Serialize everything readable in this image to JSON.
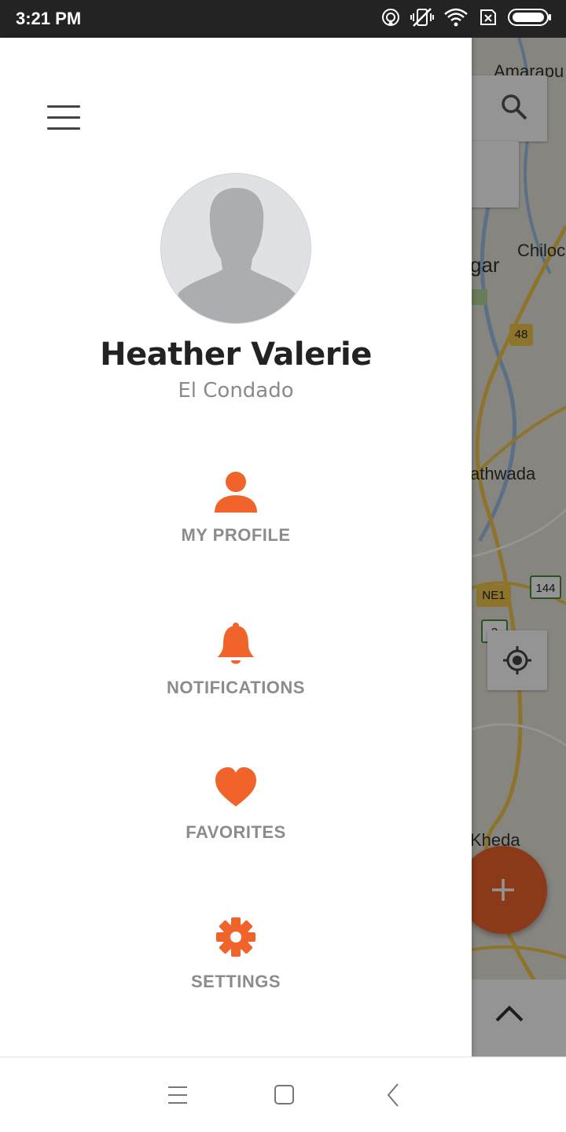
{
  "status_bar": {
    "time": "3:21 PM",
    "icons": [
      "hotspot-icon",
      "vibrate-off-icon",
      "wifi-icon",
      "no-sim-icon",
      "battery-icon"
    ]
  },
  "drawer": {
    "user": {
      "name": "Heather Valerie",
      "location": "El Condado"
    },
    "menu": [
      {
        "label": "MY PROFILE",
        "icon": "person-icon"
      },
      {
        "label": "NOTIFICATIONS",
        "icon": "bell-icon"
      },
      {
        "label": "FAVORITES",
        "icon": "heart-icon"
      },
      {
        "label": "SETTINGS",
        "icon": "gear-icon"
      }
    ],
    "accent_color": "#f0642c"
  },
  "map": {
    "labels": [
      "Amarapu",
      "Chiloc",
      "gar",
      "athwada",
      "Kheda"
    ],
    "shields": [
      "48",
      "NE1",
      "144",
      "3"
    ]
  },
  "nav_bar": {
    "icons": [
      "menu-icon",
      "home-icon",
      "back-icon"
    ]
  }
}
